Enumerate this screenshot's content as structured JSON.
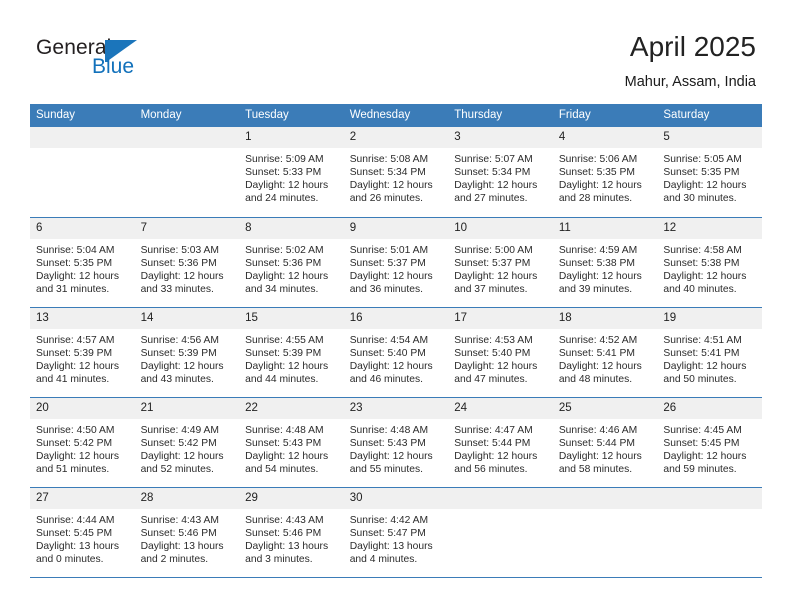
{
  "logo": {
    "text_primary": "General",
    "text_secondary": "Blue",
    "icon": "flag-triangle-icon"
  },
  "header": {
    "title": "April 2025",
    "subtitle": "Mahur, Assam, India"
  },
  "colors": {
    "header_blue": "#3b7cb8",
    "logo_blue": "#1b75bb",
    "daynum_band": "#f0f0f0",
    "text": "#222222"
  },
  "calendar": {
    "weekday_headers": [
      "Sunday",
      "Monday",
      "Tuesday",
      "Wednesday",
      "Thursday",
      "Friday",
      "Saturday"
    ],
    "labels": {
      "sunrise": "Sunrise:",
      "sunset": "Sunset:",
      "daylight": "Daylight:"
    },
    "weeks": [
      [
        {
          "day": "",
          "blank": true
        },
        {
          "day": "",
          "blank": true
        },
        {
          "day": "1",
          "sunrise": "Sunrise: 5:09 AM",
          "sunset": "Sunset: 5:33 PM",
          "daylight_1": "Daylight: 12 hours",
          "daylight_2": "and 24 minutes."
        },
        {
          "day": "2",
          "sunrise": "Sunrise: 5:08 AM",
          "sunset": "Sunset: 5:34 PM",
          "daylight_1": "Daylight: 12 hours",
          "daylight_2": "and 26 minutes."
        },
        {
          "day": "3",
          "sunrise": "Sunrise: 5:07 AM",
          "sunset": "Sunset: 5:34 PM",
          "daylight_1": "Daylight: 12 hours",
          "daylight_2": "and 27 minutes."
        },
        {
          "day": "4",
          "sunrise": "Sunrise: 5:06 AM",
          "sunset": "Sunset: 5:35 PM",
          "daylight_1": "Daylight: 12 hours",
          "daylight_2": "and 28 minutes."
        },
        {
          "day": "5",
          "sunrise": "Sunrise: 5:05 AM",
          "sunset": "Sunset: 5:35 PM",
          "daylight_1": "Daylight: 12 hours",
          "daylight_2": "and 30 minutes."
        }
      ],
      [
        {
          "day": "6",
          "sunrise": "Sunrise: 5:04 AM",
          "sunset": "Sunset: 5:35 PM",
          "daylight_1": "Daylight: 12 hours",
          "daylight_2": "and 31 minutes."
        },
        {
          "day": "7",
          "sunrise": "Sunrise: 5:03 AM",
          "sunset": "Sunset: 5:36 PM",
          "daylight_1": "Daylight: 12 hours",
          "daylight_2": "and 33 minutes."
        },
        {
          "day": "8",
          "sunrise": "Sunrise: 5:02 AM",
          "sunset": "Sunset: 5:36 PM",
          "daylight_1": "Daylight: 12 hours",
          "daylight_2": "and 34 minutes."
        },
        {
          "day": "9",
          "sunrise": "Sunrise: 5:01 AM",
          "sunset": "Sunset: 5:37 PM",
          "daylight_1": "Daylight: 12 hours",
          "daylight_2": "and 36 minutes."
        },
        {
          "day": "10",
          "sunrise": "Sunrise: 5:00 AM",
          "sunset": "Sunset: 5:37 PM",
          "daylight_1": "Daylight: 12 hours",
          "daylight_2": "and 37 minutes."
        },
        {
          "day": "11",
          "sunrise": "Sunrise: 4:59 AM",
          "sunset": "Sunset: 5:38 PM",
          "daylight_1": "Daylight: 12 hours",
          "daylight_2": "and 39 minutes."
        },
        {
          "day": "12",
          "sunrise": "Sunrise: 4:58 AM",
          "sunset": "Sunset: 5:38 PM",
          "daylight_1": "Daylight: 12 hours",
          "daylight_2": "and 40 minutes."
        }
      ],
      [
        {
          "day": "13",
          "sunrise": "Sunrise: 4:57 AM",
          "sunset": "Sunset: 5:39 PM",
          "daylight_1": "Daylight: 12 hours",
          "daylight_2": "and 41 minutes."
        },
        {
          "day": "14",
          "sunrise": "Sunrise: 4:56 AM",
          "sunset": "Sunset: 5:39 PM",
          "daylight_1": "Daylight: 12 hours",
          "daylight_2": "and 43 minutes."
        },
        {
          "day": "15",
          "sunrise": "Sunrise: 4:55 AM",
          "sunset": "Sunset: 5:39 PM",
          "daylight_1": "Daylight: 12 hours",
          "daylight_2": "and 44 minutes."
        },
        {
          "day": "16",
          "sunrise": "Sunrise: 4:54 AM",
          "sunset": "Sunset: 5:40 PM",
          "daylight_1": "Daylight: 12 hours",
          "daylight_2": "and 46 minutes."
        },
        {
          "day": "17",
          "sunrise": "Sunrise: 4:53 AM",
          "sunset": "Sunset: 5:40 PM",
          "daylight_1": "Daylight: 12 hours",
          "daylight_2": "and 47 minutes."
        },
        {
          "day": "18",
          "sunrise": "Sunrise: 4:52 AM",
          "sunset": "Sunset: 5:41 PM",
          "daylight_1": "Daylight: 12 hours",
          "daylight_2": "and 48 minutes."
        },
        {
          "day": "19",
          "sunrise": "Sunrise: 4:51 AM",
          "sunset": "Sunset: 5:41 PM",
          "daylight_1": "Daylight: 12 hours",
          "daylight_2": "and 50 minutes."
        }
      ],
      [
        {
          "day": "20",
          "sunrise": "Sunrise: 4:50 AM",
          "sunset": "Sunset: 5:42 PM",
          "daylight_1": "Daylight: 12 hours",
          "daylight_2": "and 51 minutes."
        },
        {
          "day": "21",
          "sunrise": "Sunrise: 4:49 AM",
          "sunset": "Sunset: 5:42 PM",
          "daylight_1": "Daylight: 12 hours",
          "daylight_2": "and 52 minutes."
        },
        {
          "day": "22",
          "sunrise": "Sunrise: 4:48 AM",
          "sunset": "Sunset: 5:43 PM",
          "daylight_1": "Daylight: 12 hours",
          "daylight_2": "and 54 minutes."
        },
        {
          "day": "23",
          "sunrise": "Sunrise: 4:48 AM",
          "sunset": "Sunset: 5:43 PM",
          "daylight_1": "Daylight: 12 hours",
          "daylight_2": "and 55 minutes."
        },
        {
          "day": "24",
          "sunrise": "Sunrise: 4:47 AM",
          "sunset": "Sunset: 5:44 PM",
          "daylight_1": "Daylight: 12 hours",
          "daylight_2": "and 56 minutes."
        },
        {
          "day": "25",
          "sunrise": "Sunrise: 4:46 AM",
          "sunset": "Sunset: 5:44 PM",
          "daylight_1": "Daylight: 12 hours",
          "daylight_2": "and 58 minutes."
        },
        {
          "day": "26",
          "sunrise": "Sunrise: 4:45 AM",
          "sunset": "Sunset: 5:45 PM",
          "daylight_1": "Daylight: 12 hours",
          "daylight_2": "and 59 minutes."
        }
      ],
      [
        {
          "day": "27",
          "sunrise": "Sunrise: 4:44 AM",
          "sunset": "Sunset: 5:45 PM",
          "daylight_1": "Daylight: 13 hours",
          "daylight_2": "and 0 minutes."
        },
        {
          "day": "28",
          "sunrise": "Sunrise: 4:43 AM",
          "sunset": "Sunset: 5:46 PM",
          "daylight_1": "Daylight: 13 hours",
          "daylight_2": "and 2 minutes."
        },
        {
          "day": "29",
          "sunrise": "Sunrise: 4:43 AM",
          "sunset": "Sunset: 5:46 PM",
          "daylight_1": "Daylight: 13 hours",
          "daylight_2": "and 3 minutes."
        },
        {
          "day": "30",
          "sunrise": "Sunrise: 4:42 AM",
          "sunset": "Sunset: 5:47 PM",
          "daylight_1": "Daylight: 13 hours",
          "daylight_2": "and 4 minutes."
        },
        {
          "day": "",
          "blank": true
        },
        {
          "day": "",
          "blank": true
        },
        {
          "day": "",
          "blank": true
        }
      ]
    ]
  }
}
